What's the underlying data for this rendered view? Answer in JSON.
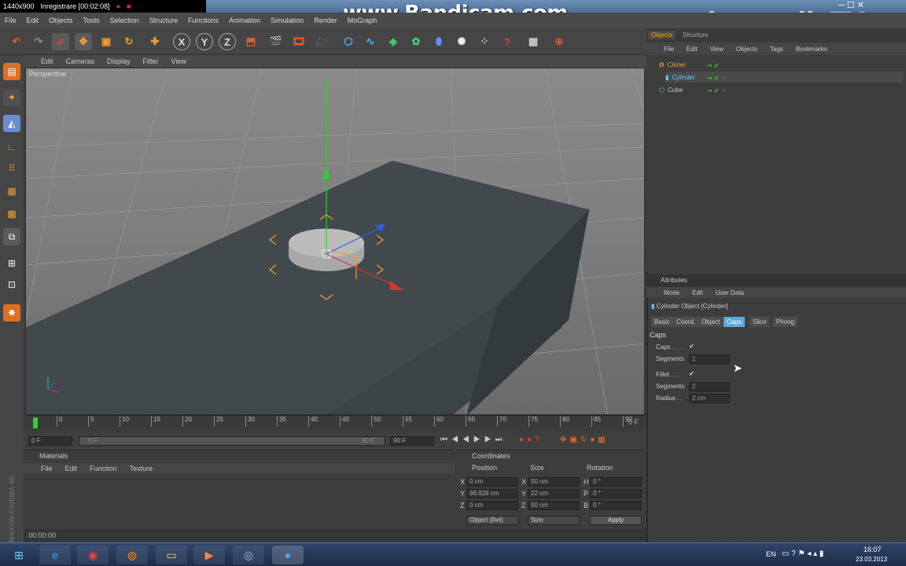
{
  "recorder": {
    "resolution": "1440x900",
    "status": "Inregistrare [00:02:08]",
    "watermark": "www.Bandicam.com"
  },
  "brand_watermark": "laumediaTV",
  "menubar": [
    "File",
    "Edit",
    "Objects",
    "Tools",
    "Selection",
    "Structure",
    "Functions",
    "Animation",
    "Simulation",
    "Render",
    "MoGraph"
  ],
  "viewport": {
    "menu": [
      "Edit",
      "Cameras",
      "Display",
      "Filter",
      "View"
    ],
    "label": "Perspective"
  },
  "timeline": {
    "ticks": [
      "0",
      "5",
      "10",
      "15",
      "20",
      "25",
      "30",
      "35",
      "40",
      "45",
      "50",
      "55",
      "60",
      "65",
      "70",
      "75",
      "80",
      "85",
      "90"
    ],
    "end_frame": "0 F",
    "start_field": "0 F",
    "start_field2": "0 F",
    "end_field": "90 F",
    "end_field2": "90 F"
  },
  "materials": {
    "title": "Materials",
    "menu": [
      "File",
      "Edit",
      "Function",
      "Texture"
    ]
  },
  "coordinates": {
    "title": "Coordinates",
    "headers": [
      "Position",
      "Size",
      "Rotation"
    ],
    "rows": [
      {
        "axis": "X",
        "pos": "0 cm",
        "size_axis": "X",
        "size": "50 cm",
        "rot_axis": "H",
        "rot": "0 °"
      },
      {
        "axis": "Y",
        "pos": "98.828 cm",
        "size_axis": "Y",
        "size": "22 cm",
        "rot_axis": "P",
        "rot": "0 °"
      },
      {
        "axis": "Z",
        "pos": "0 cm",
        "size_axis": "Z",
        "size": "50 cm",
        "rot_axis": "B",
        "rot": "0 °"
      }
    ],
    "mode": "Object (Rel)",
    "size_mode": "Size",
    "apply": "Apply"
  },
  "status_time": "00:00:00",
  "objects_panel": {
    "tabs": [
      "Objects",
      "Structure"
    ],
    "menu": [
      "File",
      "Edit",
      "View",
      "Objects",
      "Tags",
      "Bookmarks"
    ],
    "items": [
      {
        "name": "Cloner",
        "color": "#e8a030"
      },
      {
        "name": "Cylinder",
        "color": "#6cc8ff"
      },
      {
        "name": "Cube",
        "color": "#c8c8c8"
      }
    ]
  },
  "attributes": {
    "title": "Attributes",
    "menu": [
      "Mode",
      "Edit",
      "User Data"
    ],
    "object": "Cylinder Object [Cylinder]",
    "tabs": [
      "Basic",
      "Coord.",
      "Object",
      "Caps",
      "Slice",
      "Phong"
    ],
    "active_tab": "Caps",
    "section": "Caps",
    "fields": [
      {
        "label": "Caps . . . .",
        "value": "✔"
      },
      {
        "label": "Segments",
        "value": "1"
      },
      {
        "label": "Fillet . . .",
        "value": "✔"
      },
      {
        "label": "Segments",
        "value": "2"
      },
      {
        "label": "Radius . .",
        "value": "2 cm"
      }
    ]
  },
  "side_brand": "MAXON CINEMA 4D",
  "taskbar": {
    "lang": "EN",
    "time": "16:07",
    "date": "23.03.2013"
  },
  "colors": {
    "accent": "#f0a030",
    "active_tab": "#5fa8d8",
    "axis_x": "#e03030",
    "axis_y": "#30d030",
    "axis_z": "#3060f0"
  }
}
